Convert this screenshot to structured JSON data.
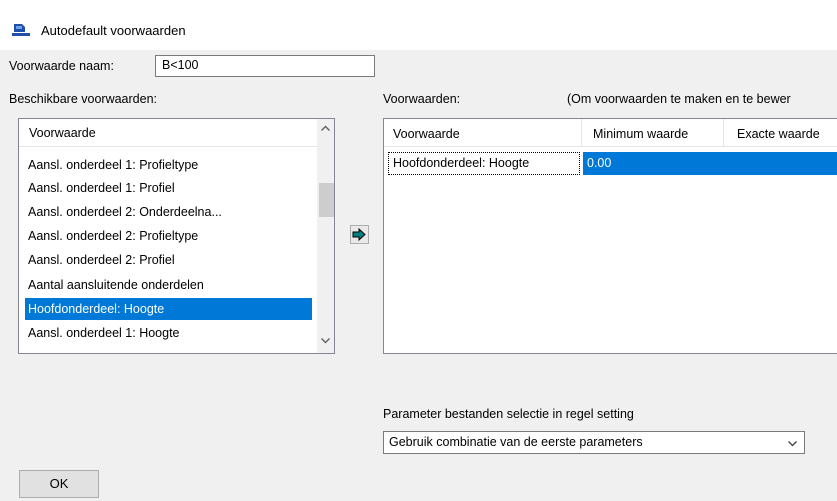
{
  "window": {
    "title": "Autodefault voorwaarden"
  },
  "name_field": {
    "label": "Voorwaarde naam:",
    "value": "B<100"
  },
  "available": {
    "label": "Beschikbare voorwaarden:",
    "column": "Voorwaarde",
    "items": [
      "Aansl. onderdeel 1: Profieltype",
      "Aansl. onderdeel 1: Profiel",
      "Aansl. onderdeel 2: Onderdeelna...",
      "Aansl. onderdeel 2: Profieltype",
      "Aansl. onderdeel 2: Profiel",
      "Aantal aansluitende onderdelen",
      "Hoofdonderdeel: Hoogte",
      "Aansl. onderdeel 1: Hoogte"
    ],
    "selected_index": 6
  },
  "conditions": {
    "label": "Voorwaarden:",
    "hint": "(Om voorwaarden te maken en te bewer",
    "columns": [
      "Voorwaarde",
      "Minimum waarde",
      "Exacte waarde"
    ],
    "rows": [
      {
        "condition": "Hoofdonderdeel: Hoogte",
        "minimum": "0.00",
        "exact": ""
      }
    ]
  },
  "parameter": {
    "label": "Parameter bestanden selectie in regel setting",
    "selected": "Gebruik combinatie van de eerste parameters"
  },
  "ok_label": "OK",
  "colors": {
    "selection": "#0078d7",
    "arrow": "#008080"
  }
}
